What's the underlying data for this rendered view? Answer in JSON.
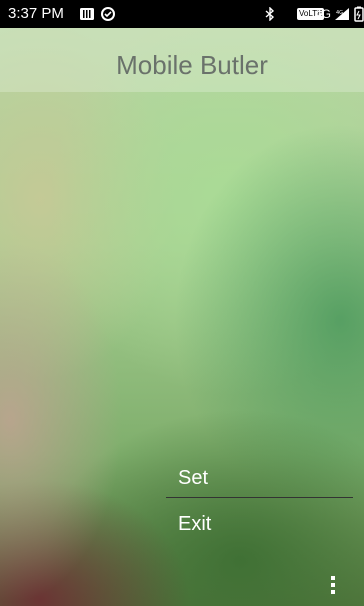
{
  "status_bar": {
    "time": "3:37 PM",
    "volte": "VoLTE",
    "network": "4G",
    "signal_label": "4G"
  },
  "app_bar": {
    "title": "Mobile Butler"
  },
  "menu": {
    "items": [
      {
        "label": "Set"
      },
      {
        "label": "Exit"
      }
    ]
  },
  "colors": {
    "title_text": "#6a726b",
    "status_bar_bg": "#000000",
    "menu_text": "#ffffff"
  },
  "icons": {
    "overflow": "more-vert-icon"
  }
}
